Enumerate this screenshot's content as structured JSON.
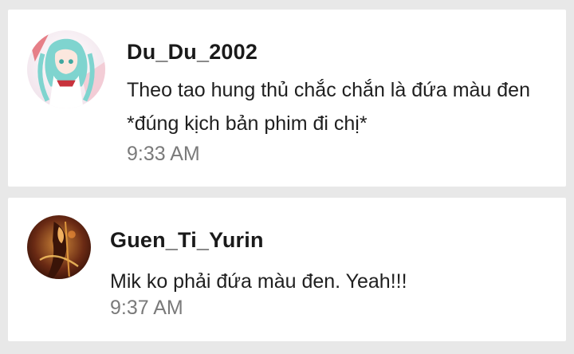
{
  "comments": [
    {
      "username": "Du_Du_2002",
      "message": "Theo tao hung thủ chắc chắn là đứa màu đen *đúng kịch bản phim đi chị*",
      "time": "9:33 AM"
    },
    {
      "username": "Guen_Ti_Yurin",
      "message": "Mik ko phải đứa màu đen. Yeah!!!",
      "time": "9:37 AM"
    }
  ],
  "colors": {
    "background": "#e8e8e8",
    "card": "#ffffff",
    "username": "#1a1a1a",
    "message": "#1f1f1f",
    "timestamp": "#7a7a7a"
  }
}
